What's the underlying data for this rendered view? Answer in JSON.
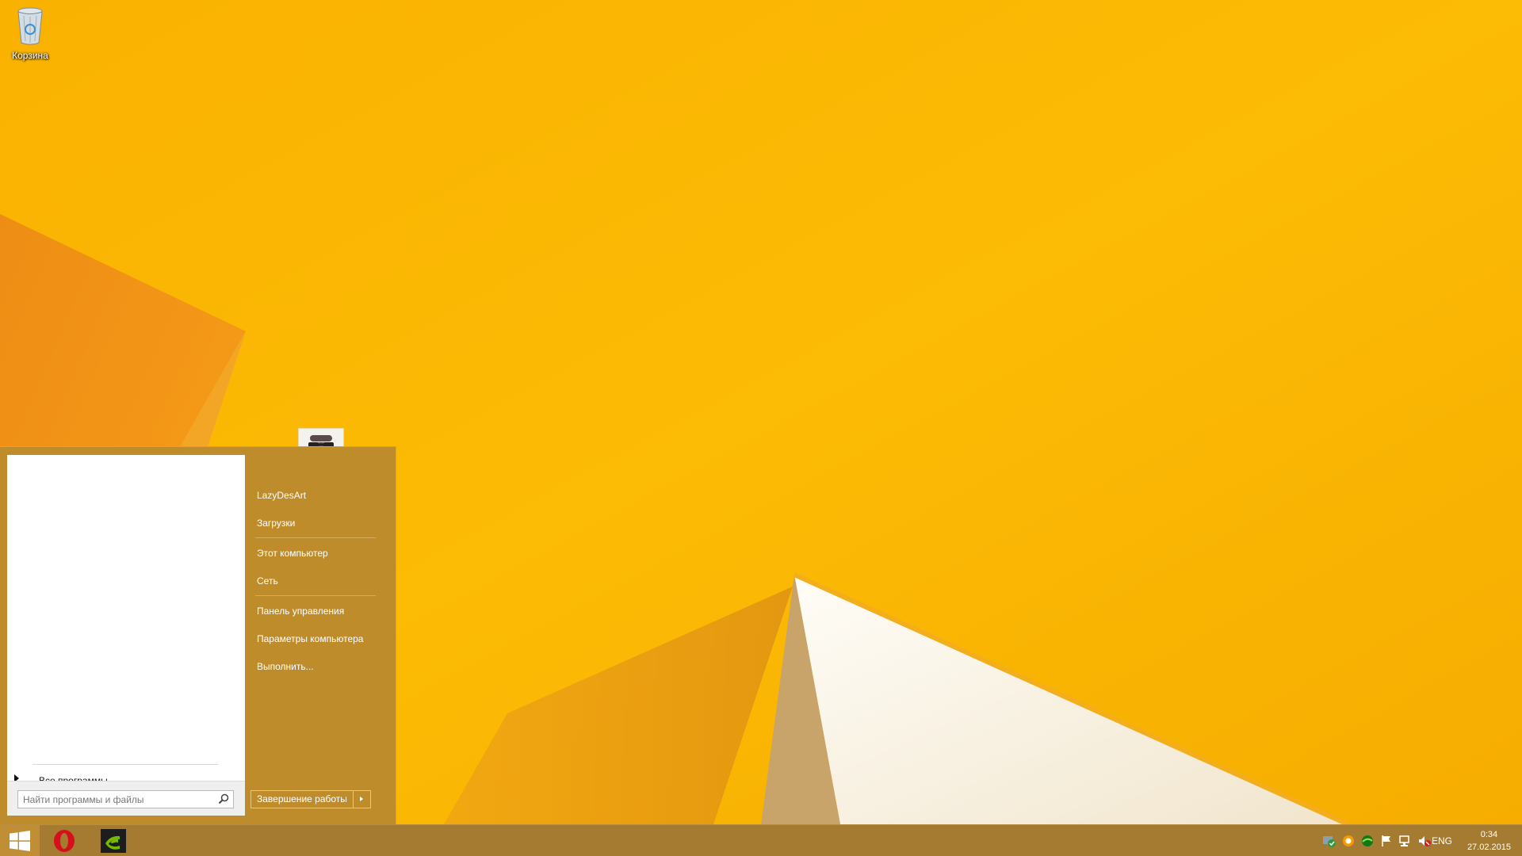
{
  "desktop": {
    "icons": [
      {
        "label": "Корзина",
        "icon": "recycle-bin-icon"
      }
    ]
  },
  "start_menu": {
    "all_programs_label": "Все программы",
    "search": {
      "placeholder": "Найти программы и файлы",
      "value": ""
    },
    "user": {
      "name": "LazyDesArt",
      "avatar": "user-avatar"
    },
    "items": [
      {
        "label": "LazyDesArt"
      },
      {
        "label": "Загрузки"
      },
      {
        "label": "Этот компьютер"
      },
      {
        "label": "Сеть"
      },
      {
        "label": "Панель управления"
      },
      {
        "label": "Параметры компьютера"
      },
      {
        "label": "Выполнить..."
      }
    ],
    "shutdown_label": "Завершение работы"
  },
  "taskbar": {
    "pinned": [
      {
        "icon": "windows-logo-icon"
      },
      {
        "icon": "opera-icon"
      },
      {
        "icon": "nvidia-icon"
      }
    ],
    "tray": {
      "language": "ENG",
      "time": "0:34",
      "date": "27.02.2015",
      "icons": [
        "security-icon",
        "updater-icon",
        "nvidia-tray-icon",
        "action-center-flag-icon",
        "network-icon",
        "volume-muted-icon"
      ]
    }
  },
  "colors": {
    "accent": "#bf8c2c",
    "taskbar": "#a47b31",
    "wallpaper": "#f8b400"
  }
}
